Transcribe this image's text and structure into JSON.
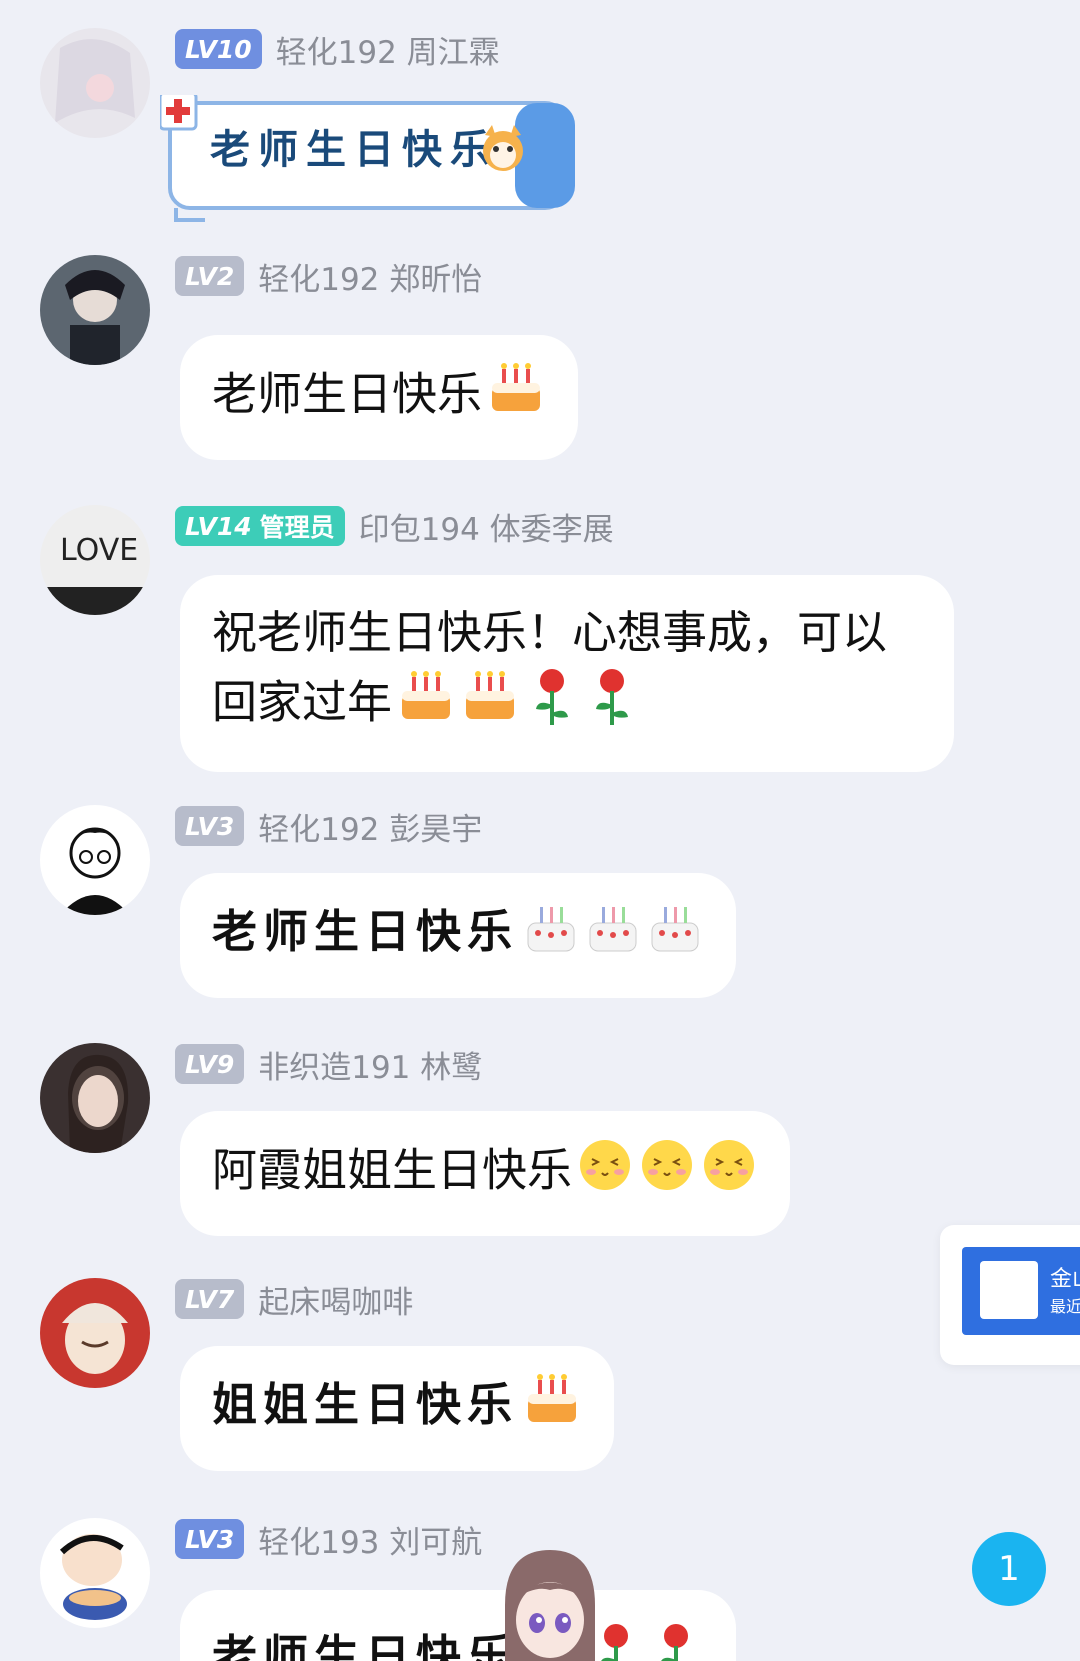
{
  "messages": [
    {
      "level": "LV10",
      "role": "",
      "name": "轻化192 周江霖",
      "text": "老师生日快乐",
      "emoji": [
        "cat"
      ]
    },
    {
      "level": "LV2",
      "role": "",
      "name": "轻化192 郑昕怡",
      "text": "老师生日快乐",
      "emoji": [
        "cake"
      ]
    },
    {
      "level": "LV14",
      "role": "管理员",
      "name": "印包194 体委李展",
      "text_line1": "祝老师生日快乐！心想事成，可以",
      "text_line2": "回家过年",
      "emoji": [
        "cake",
        "cake",
        "rose",
        "rose"
      ]
    },
    {
      "level": "LV3",
      "role": "",
      "name": "轻化192 彭昊宇",
      "text": "老师生日快乐",
      "emoji": [
        "cake-white",
        "cake-white",
        "cake-white"
      ]
    },
    {
      "level": "LV9",
      "role": "",
      "name": "非织造191 林鹭",
      "text": "阿霞姐姐生日快乐",
      "emoji": [
        "blush",
        "blush",
        "blush"
      ]
    },
    {
      "level": "LV7",
      "role": "",
      "name": "起床喝咖啡",
      "text": "姐姐生日快乐",
      "emoji": [
        "cake"
      ]
    },
    {
      "level": "LV3",
      "role": "",
      "name": "轻化193 刘可航",
      "text": "老师生日快乐",
      "emoji": [
        "rose",
        "rose"
      ]
    }
  ],
  "side_card": {
    "title": "金山",
    "subtitle": "最近"
  },
  "unread_count": "1",
  "colors": {
    "background": "#eef0f7",
    "bubble": "#ffffff",
    "name": "#8a8d96",
    "badge_gray": "#b7bccb",
    "badge_admin": "#3dcdb8",
    "badge_blue": "#6f8fe0",
    "unread": "#1ab4f0"
  }
}
